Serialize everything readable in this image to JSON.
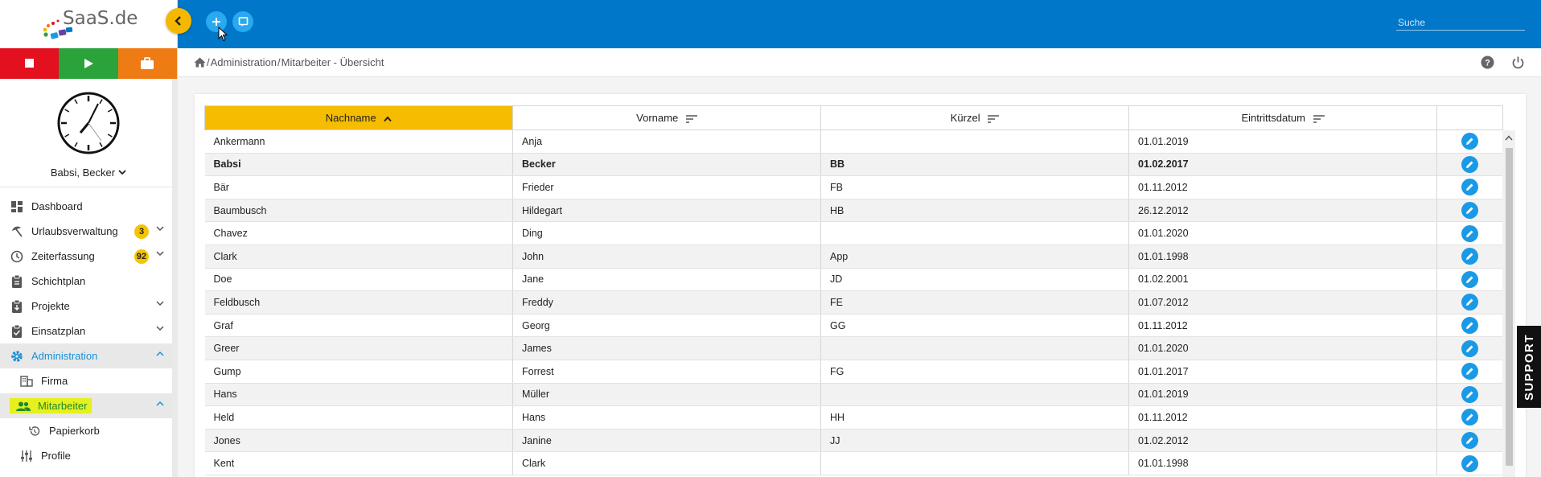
{
  "app": {
    "logo_text": "SaaS.de"
  },
  "user": {
    "name": "Babsi, Becker"
  },
  "header": {
    "search_placeholder": "Suche"
  },
  "breadcrumb": {
    "home_sep": "/",
    "items": [
      "Administration",
      "Mitarbeiter - Übersicht"
    ],
    "separator": "/"
  },
  "sidebar": {
    "items": [
      {
        "label": "Dashboard",
        "icon": "dashboard-icon"
      },
      {
        "label": "Urlaubsverwaltung",
        "icon": "beach-umbrella-icon",
        "badge": "3"
      },
      {
        "label": "Zeiterfassung",
        "icon": "clock-icon",
        "badge": "92"
      },
      {
        "label": "Schichtplan",
        "icon": "clipboard-icon"
      },
      {
        "label": "Projekte",
        "icon": "clipboard-download-icon"
      },
      {
        "label": "Einsatzplan",
        "icon": "clipboard-check-icon"
      },
      {
        "label": "Administration",
        "icon": "gear-icon"
      },
      {
        "label": "Firma",
        "icon": "building-icon"
      },
      {
        "label": "Mitarbeiter",
        "icon": "people-icon"
      },
      {
        "label": "Papierkorb",
        "icon": "restore-icon"
      },
      {
        "label": "Profile",
        "icon": "sliders-icon"
      }
    ]
  },
  "table": {
    "columns": [
      "Nachname",
      "Vorname",
      "Kürzel",
      "Eintrittsdatum"
    ],
    "rows": [
      [
        "Ankermann",
        "Anja",
        "",
        "01.01.2019"
      ],
      [
        "Babsi",
        "Becker",
        "BB",
        "01.02.2017"
      ],
      [
        "Bär",
        "Frieder",
        "FB",
        "01.11.2012"
      ],
      [
        "Baumbusch",
        "Hildegart",
        "HB",
        "26.12.2012"
      ],
      [
        "Chavez",
        "Ding",
        "",
        "01.01.2020"
      ],
      [
        "Clark",
        "John",
        "App",
        "01.01.1998"
      ],
      [
        "Doe",
        "Jane",
        "JD",
        "01.02.2001"
      ],
      [
        "Feldbusch",
        "Freddy",
        "FE",
        "01.07.2012"
      ],
      [
        "Graf",
        "Georg",
        "GG",
        "01.11.2012"
      ],
      [
        "Greer",
        "James",
        "",
        "01.01.2020"
      ],
      [
        "Gump",
        "Forrest",
        "FG",
        "01.01.2017"
      ],
      [
        "Hans",
        "Müller",
        "",
        "01.01.2019"
      ],
      [
        "Held",
        "Hans",
        "HH",
        "01.11.2012"
      ],
      [
        "Jones",
        "Janine",
        "JJ",
        "01.02.2012"
      ],
      [
        "Kent",
        "Clark",
        "",
        "01.01.1998"
      ]
    ]
  },
  "support": {
    "label": "SUPPORT"
  },
  "colors": {
    "header": "#0077c8",
    "accent": "#f5b800",
    "active_text": "#1a8fd6",
    "highlight": "#e6f01e"
  }
}
